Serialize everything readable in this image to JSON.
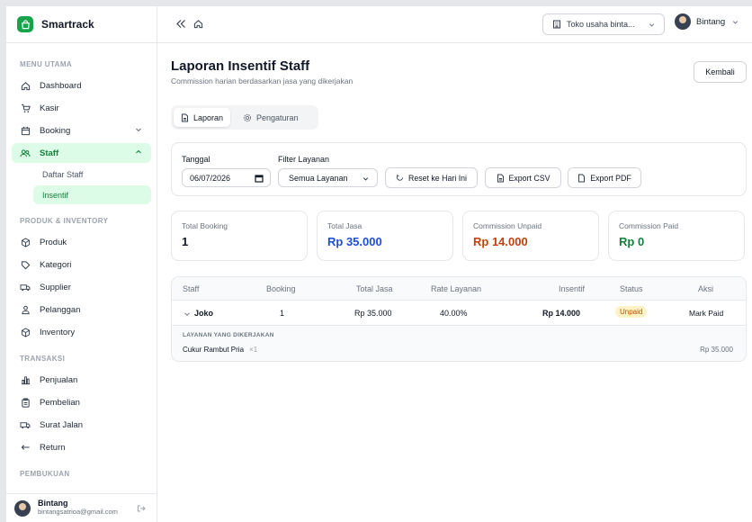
{
  "sidebar": {
    "brand": "Smartrack",
    "sections": {
      "main": "MENU UTAMA",
      "produk": "PRODUK & INVENTORY",
      "transaksi": "TRANSAKSI",
      "pembukuan": "PEMBUKUAN"
    },
    "items": {
      "dashboard": "Dashboard",
      "kasir": "Kasir",
      "booking": "Booking",
      "staff": "Staff",
      "daftar_staff": "Daftar Staff",
      "insentif": "Insentif",
      "produk": "Produk",
      "kategori": "Kategori",
      "supplier": "Supplier",
      "pelanggan": "Pelanggan",
      "inventory": "Inventory",
      "penjualan": "Penjualan",
      "pembelian": "Pembelian",
      "surat_jalan": "Surat Jalan",
      "return": "Return"
    },
    "user": {
      "name": "Bintang",
      "email": "bintangsatrioa@gmail.com"
    }
  },
  "topbar": {
    "store": "Toko usaha binta...",
    "user": "Bintang"
  },
  "page": {
    "title": "Laporan Insentif Staff",
    "subtitle": "Commission harian berdasarkan jasa yang dikerjakan",
    "back": "Kembali"
  },
  "tabs": {
    "laporan": "Laporan",
    "pengaturan": "Pengaturan"
  },
  "filters": {
    "date_label": "Tanggal",
    "date_value": "06/07/2026",
    "service_label": "Filter Layanan",
    "service_value": "Semua Layanan",
    "reset": "Reset ke Hari Ini",
    "csv": "Export CSV",
    "pdf": "Export PDF"
  },
  "stats": [
    {
      "label": "Total Booking",
      "value": "1",
      "color": "#111827"
    },
    {
      "label": "Total Jasa",
      "value": "Rp 35.000",
      "color": "#1d4ed8"
    },
    {
      "label": "Commission Unpaid",
      "value": "Rp 14.000",
      "color": "#c2410c"
    },
    {
      "label": "Commission Paid",
      "value": "Rp 0",
      "color": "#15803d"
    }
  ],
  "table": {
    "headers": [
      "Staff",
      "Booking",
      "Total Jasa",
      "Rate Layanan",
      "Insentif",
      "Status",
      "Aksi"
    ],
    "row": {
      "staff": "Joko",
      "booking": "1",
      "total_jasa": "Rp 35.000",
      "rate": "40.00%",
      "insentif": "Rp 14.000",
      "status": "Unpaid",
      "aksi": "Mark Paid"
    },
    "detail": {
      "title": "LAYANAN YANG DIKERJAKAN",
      "service": "Cukur Rambut Pria",
      "qty": "×1",
      "price": "Rp 35.000"
    }
  }
}
